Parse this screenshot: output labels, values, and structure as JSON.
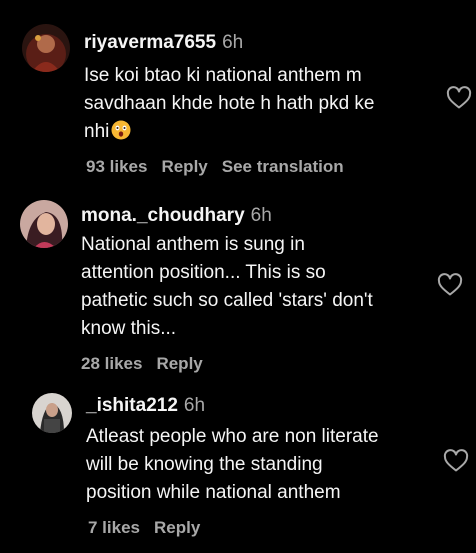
{
  "comments": [
    {
      "username": "riyaverma7655",
      "time": "6h",
      "text": "Ise koi btao ki national anthem m\nsavdhaan khde hote h hath pkd ke\nnhi",
      "emoji": "astonished-face-emoji",
      "likes": "93 likes",
      "reply": "Reply",
      "translate": "See translation"
    },
    {
      "username": "mona._choudhary",
      "time": "6h",
      "text": "National anthem is sung in\nattention position... This is so\npathetic such so called 'stars' don't\nknow this...",
      "likes": "28 likes",
      "reply": "Reply"
    },
    {
      "username": "_ishita212",
      "time": "6h",
      "text": "Atleast people who are non literate\nwill be knowing the standing\nposition while national anthem",
      "likes": "7 likes",
      "reply": "Reply"
    }
  ],
  "icons": {
    "like": "heart-outline-icon"
  },
  "colors": {
    "background": "#000000",
    "primary_text": "#f5f5f5",
    "secondary_text": "#a8a8a8"
  }
}
